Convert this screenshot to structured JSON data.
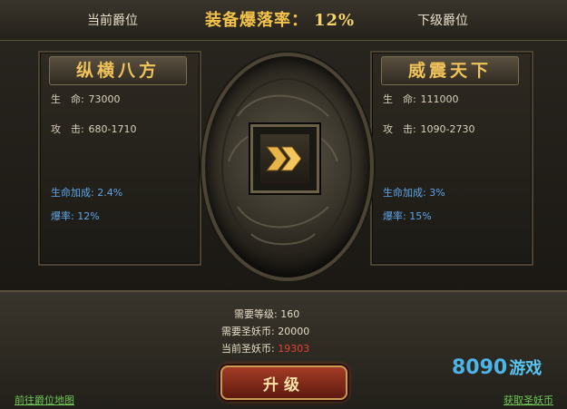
{
  "header": {
    "current_rank_label": "当前爵位",
    "drop_rate_label": "装备爆落率：",
    "drop_rate_value": "12%",
    "next_rank_label": "下级爵位"
  },
  "current": {
    "title": "纵横八方",
    "hp_label": "生　命:",
    "hp_value": "73000",
    "atk_label": "攻　击:",
    "atk_value": "680-1710",
    "hp_bonus_label": "生命加成:",
    "hp_bonus_value": "2.4%",
    "crit_label": "爆率:",
    "crit_value": "12%"
  },
  "next": {
    "title": "威震天下",
    "hp_label": "生　命:",
    "hp_value": "111000",
    "atk_label": "攻　击:",
    "atk_value": "1090-2730",
    "hp_bonus_label": "生命加成:",
    "hp_bonus_value": "3%",
    "crit_label": "爆率:",
    "crit_value": "15%"
  },
  "requirements": {
    "level_label": "需要等级:",
    "level_value": "160",
    "coin_label": "需要圣妖币:",
    "coin_value": "20000",
    "current_coin_label": "当前圣妖币:",
    "current_coin_value": "19303"
  },
  "upgrade_label": "升级",
  "links": {
    "go_map": "前往爵位地图",
    "get_coin": "获取圣妖币"
  },
  "brand": {
    "digits": "8090",
    "cn": "游戏"
  },
  "colors": {
    "gold": "#f2c24a",
    "blue_stat": "#5fa6ea",
    "red_value": "#e3432e",
    "link_green": "#6ec957"
  }
}
